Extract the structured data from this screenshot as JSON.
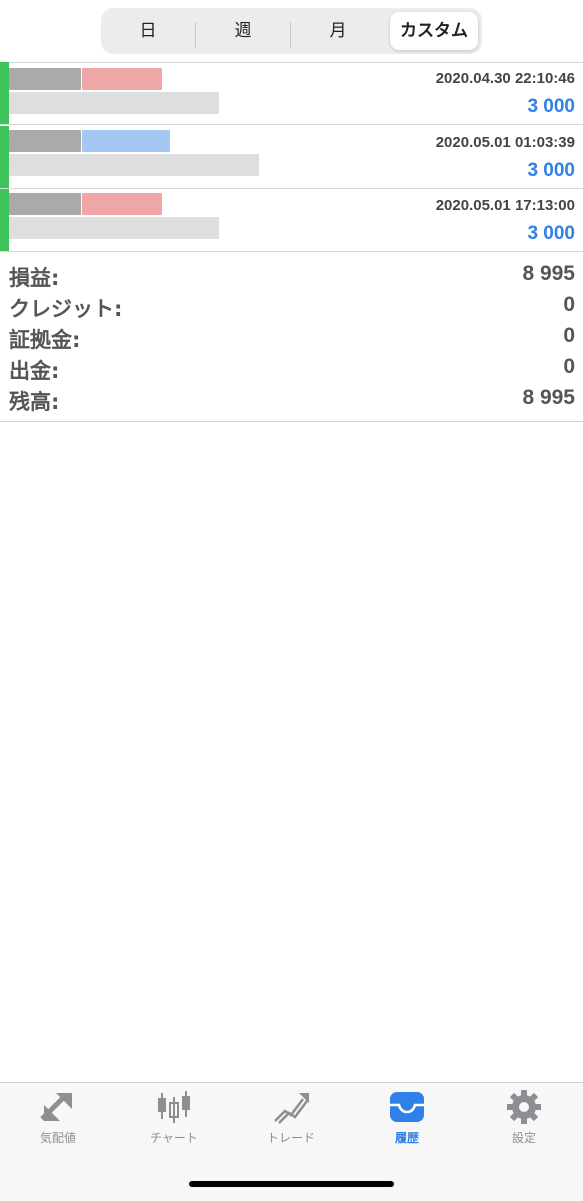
{
  "segmented": {
    "items": [
      "日",
      "週",
      "月",
      "カスタム"
    ],
    "selected": "カスタム"
  },
  "deals": [
    {
      "datetime": "2020.04.30 22:10:46",
      "amount": "3 000",
      "accent": "#e36b6b"
    },
    {
      "datetime": "2020.05.01 01:03:39",
      "amount": "3 000",
      "accent": "#5b9be8"
    },
    {
      "datetime": "2020.05.01 17:13:00",
      "amount": "3 000",
      "accent": "#e36b6b"
    }
  ],
  "summary": [
    {
      "label": "損益:",
      "value": "8 995"
    },
    {
      "label": "クレジット:",
      "value": "0"
    },
    {
      "label": "証拠金:",
      "value": "0"
    },
    {
      "label": "出金:",
      "value": "0"
    },
    {
      "label": "残高:",
      "value": "8 995"
    }
  ],
  "tabbar": {
    "items": [
      {
        "label": "気配値",
        "icon": "quotes-icon"
      },
      {
        "label": "チャート",
        "icon": "chart-icon"
      },
      {
        "label": "トレード",
        "icon": "trade-icon"
      },
      {
        "label": "履歴",
        "icon": "history-icon"
      },
      {
        "label": "設定",
        "icon": "settings-icon"
      }
    ],
    "active": "履歴"
  },
  "colors": {
    "accent_blue": "#2f80e8",
    "deal_bar_green": "#3ec35a",
    "text_gray": "#555555"
  }
}
